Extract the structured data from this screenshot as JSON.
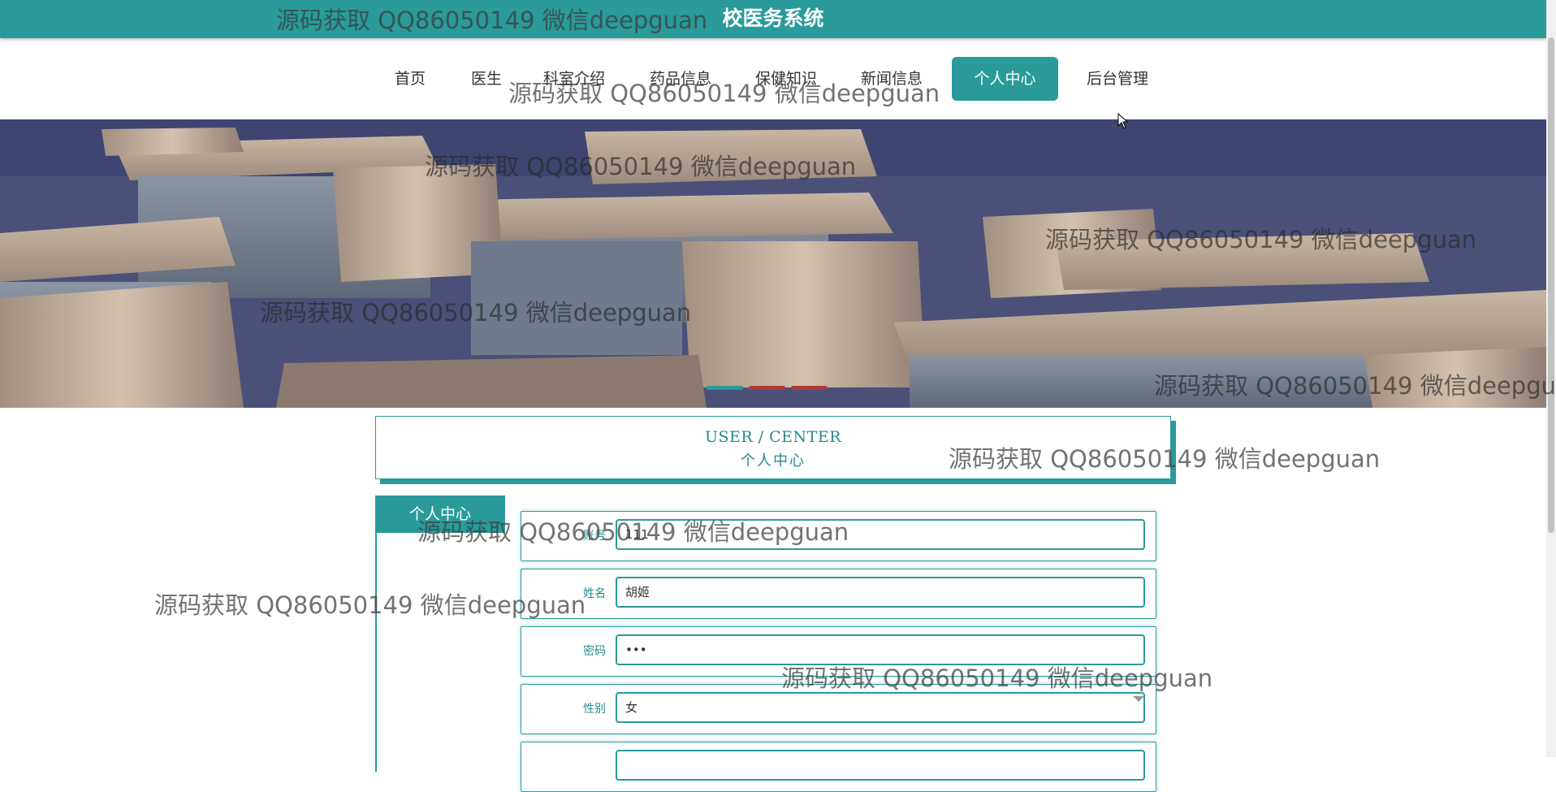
{
  "header": {
    "title": "校医务系统"
  },
  "nav": {
    "items": [
      {
        "label": "首页"
      },
      {
        "label": "医生"
      },
      {
        "label": "科室介绍"
      },
      {
        "label": "药品信息"
      },
      {
        "label": "保健知识"
      },
      {
        "label": "新闻信息"
      },
      {
        "label": "个人中心"
      },
      {
        "label": "后台管理"
      }
    ],
    "active": "个人中心"
  },
  "section": {
    "title_en": "USER / CENTER",
    "title_cn": "个人中心"
  },
  "sidebar": {
    "tab": "个人中心"
  },
  "form": {
    "fields": [
      {
        "label": "账号",
        "value": "111"
      },
      {
        "label": "姓名",
        "value": "胡姬"
      },
      {
        "label": "密码",
        "value": "•••"
      },
      {
        "label": "性别",
        "value": "女"
      },
      {
        "label": "",
        "value": ""
      }
    ]
  },
  "watermark": {
    "text": "源码获取 QQ86050149 微信deepguan"
  },
  "colors": {
    "accent": "#2a9a9a",
    "dot_active": "#2a9a9a",
    "dot_inactive": "#c0392b"
  }
}
